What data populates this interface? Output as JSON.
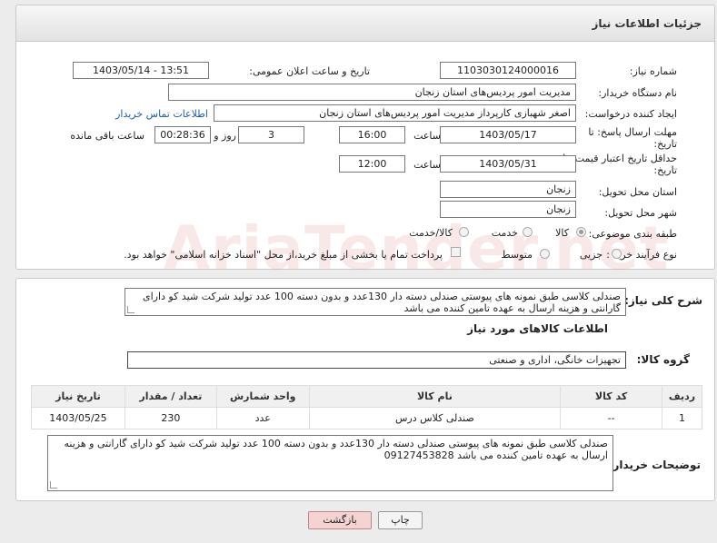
{
  "header": {
    "title": "جزئیات اطلاعات نیاز"
  },
  "fields": {
    "need_number_label": "شماره نیاز:",
    "need_number": "1103030124000016",
    "announce_label": "تاریخ و ساعت اعلان عمومی:",
    "announce_value": "1403/05/14 - 13:51",
    "buyer_org_label": "نام دستگاه خریدار:",
    "buyer_org": "مدیریت امور پردیس‌های استان زنجان",
    "creator_label": "ایجاد کننده درخواست:",
    "creator": "اصغر  شهبازی  کارپرداز  مدیریت امور پردیس‌های استان زنجان",
    "contact_link": "اطلاعات تماس خریدار",
    "deadline_label_1": "مهلت ارسال پاسخ: تا",
    "deadline_label_2": "تاریخ:",
    "deadline_date": "1403/05/17",
    "time_label": "ساعت",
    "deadline_time": "16:00",
    "day_word": "روز و",
    "days": "3",
    "remaining_time": "00:28:36",
    "remaining_label": "ساعت باقی مانده",
    "validity_label_1": "حداقل تاریخ اعتبار قیمت: تا",
    "validity_label_2": "تاریخ:",
    "validity_date": "1403/05/31",
    "validity_time": "12:00",
    "province_label": "استان محل تحویل:",
    "province": "زنجان",
    "city_label": "شهر محل تحویل:",
    "city": "زنجان",
    "category_label": "طبقه بندی موضوعی:",
    "cat_goods": "کالا",
    "cat_service": "خدمت",
    "cat_both": "کالا/خدمت",
    "process_label": "نوع فرآیند خرید :",
    "proc_partial": "جزیی",
    "proc_medium": "متوسط",
    "payment_text": "پرداخت تمام یا بخشی از مبلغ خرید،از محل \"اسناد خزانه اسلامی\" خواهد بود."
  },
  "summary": {
    "label": "شرح کلی نیاز:",
    "text": "صندلی کلاسی طبق نمونه های پیوستی صندلی دسته دار 130عدد و بدون دسته 100 عدد تولید شرکت شید کو دارای گارانتی و هزینه ارسال به عهده تامین کننده می باشد"
  },
  "goods_section": {
    "title": "اطلاعات کالاهای مورد نیاز",
    "group_label": "گروه کالا:",
    "group_value": "تجهیزات خانگی، اداری و صنعتی"
  },
  "table": {
    "headers": [
      "ردیف",
      "کد کالا",
      "نام کالا",
      "واحد شمارش",
      "تعداد / مقدار",
      "تاریخ نیاز"
    ],
    "rows": [
      [
        "1",
        "--",
        "صندلی کلاس درس",
        "عدد",
        "230",
        "1403/05/25"
      ]
    ]
  },
  "buyer_notes": {
    "label": "توضیحات خریدار:",
    "text": "صندلی کلاسی طبق نمونه های پیوستی صندلی دسته دار 130عدد و بدون دسته 100 عدد تولید شرکت شید کو دارای گارانتی و هزینه ارسال به عهده تامین کننده می باشد 09127453828"
  },
  "buttons": {
    "print": "چاپ",
    "back": "بازگشت"
  },
  "watermark": "AriaTender.net",
  "colors": {
    "link": "#1a5fb4",
    "back_btn_bg": "#f6d3d3",
    "watermark": "#dc8282"
  }
}
